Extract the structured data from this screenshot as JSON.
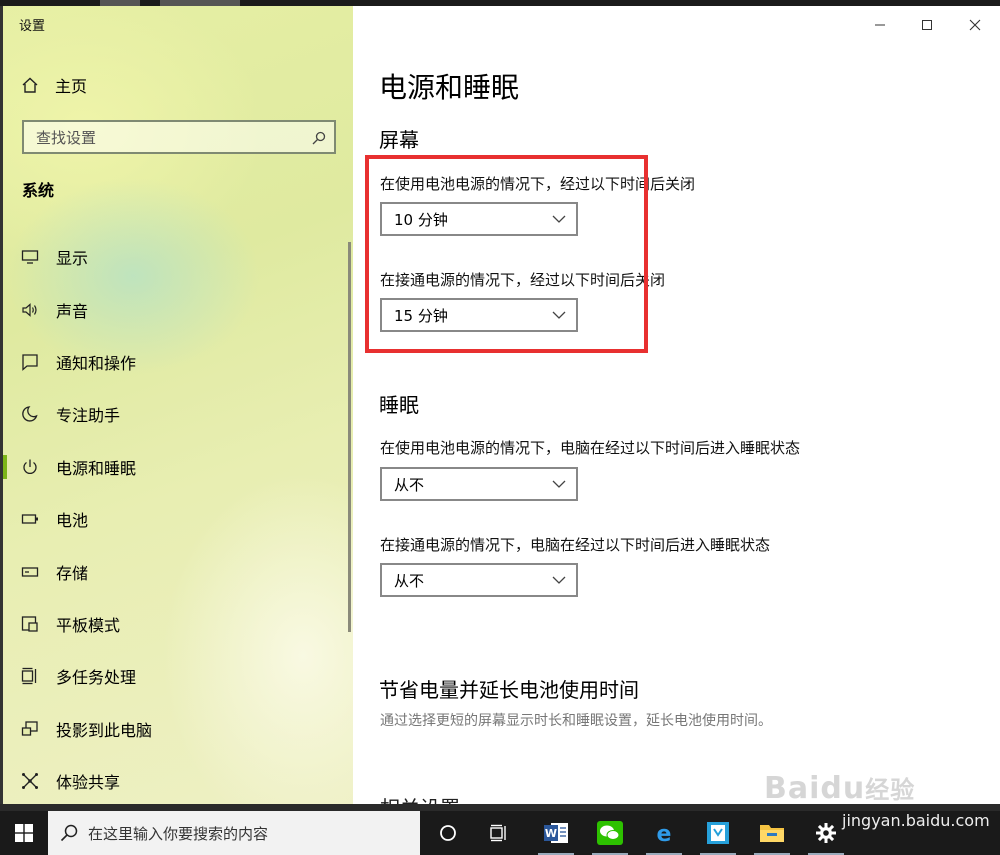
{
  "window": {
    "title": "设置",
    "controls": [
      "minimize",
      "maximize",
      "close"
    ]
  },
  "sidebar": {
    "home_label": "主页",
    "search_placeholder": "查找设置",
    "section_title": "系统",
    "items": [
      {
        "label": "显示",
        "icon": "display-icon"
      },
      {
        "label": "声音",
        "icon": "speaker-icon"
      },
      {
        "label": "通知和操作",
        "icon": "notification-icon"
      },
      {
        "label": "专注助手",
        "icon": "moon-icon"
      },
      {
        "label": "电源和睡眠",
        "icon": "power-icon",
        "active": true
      },
      {
        "label": "电池",
        "icon": "battery-icon"
      },
      {
        "label": "存储",
        "icon": "storage-icon"
      },
      {
        "label": "平板模式",
        "icon": "tablet-icon"
      },
      {
        "label": "多任务处理",
        "icon": "multitask-icon"
      },
      {
        "label": "投影到此电脑",
        "icon": "project-icon"
      },
      {
        "label": "体验共享",
        "icon": "share-icon"
      }
    ]
  },
  "content": {
    "page_title": "电源和睡眠",
    "screen": {
      "heading": "屏幕",
      "battery_label": "在使用电池电源的情况下，经过以下时间后关闭",
      "battery_value": "10 分钟",
      "plugged_label": "在接通电源的情况下，经过以下时间后关闭",
      "plugged_value": "15 分钟"
    },
    "sleep": {
      "heading": "睡眠",
      "battery_label": "在使用电池电源的情况下，电脑在经过以下时间后进入睡眠状态",
      "battery_value": "从不",
      "plugged_label": "在接通电源的情况下，电脑在经过以下时间后进入睡眠状态",
      "plugged_value": "从不"
    },
    "save": {
      "heading": "节省电量并延长电池使用时间",
      "description": "通过选择更短的屏幕显示时长和睡眠设置，延长电池使用时间。"
    },
    "related": {
      "heading": "相关设置"
    }
  },
  "taskbar": {
    "search_placeholder": "在这里输入你要搜索的内容",
    "apps": [
      "cortana-icon",
      "task-view-icon",
      "word-icon",
      "wechat-icon",
      "edge-icon",
      "app-icon",
      "file-explorer-icon",
      "settings-icon"
    ]
  },
  "watermark": {
    "logo": "Bai",
    "paw": "du",
    "text2": "经验",
    "url": "jingyan.baidu.com"
  },
  "colors": {
    "accent": "#7cb518",
    "highlight_box": "#e83030",
    "taskbar": "#1a1a1a"
  }
}
